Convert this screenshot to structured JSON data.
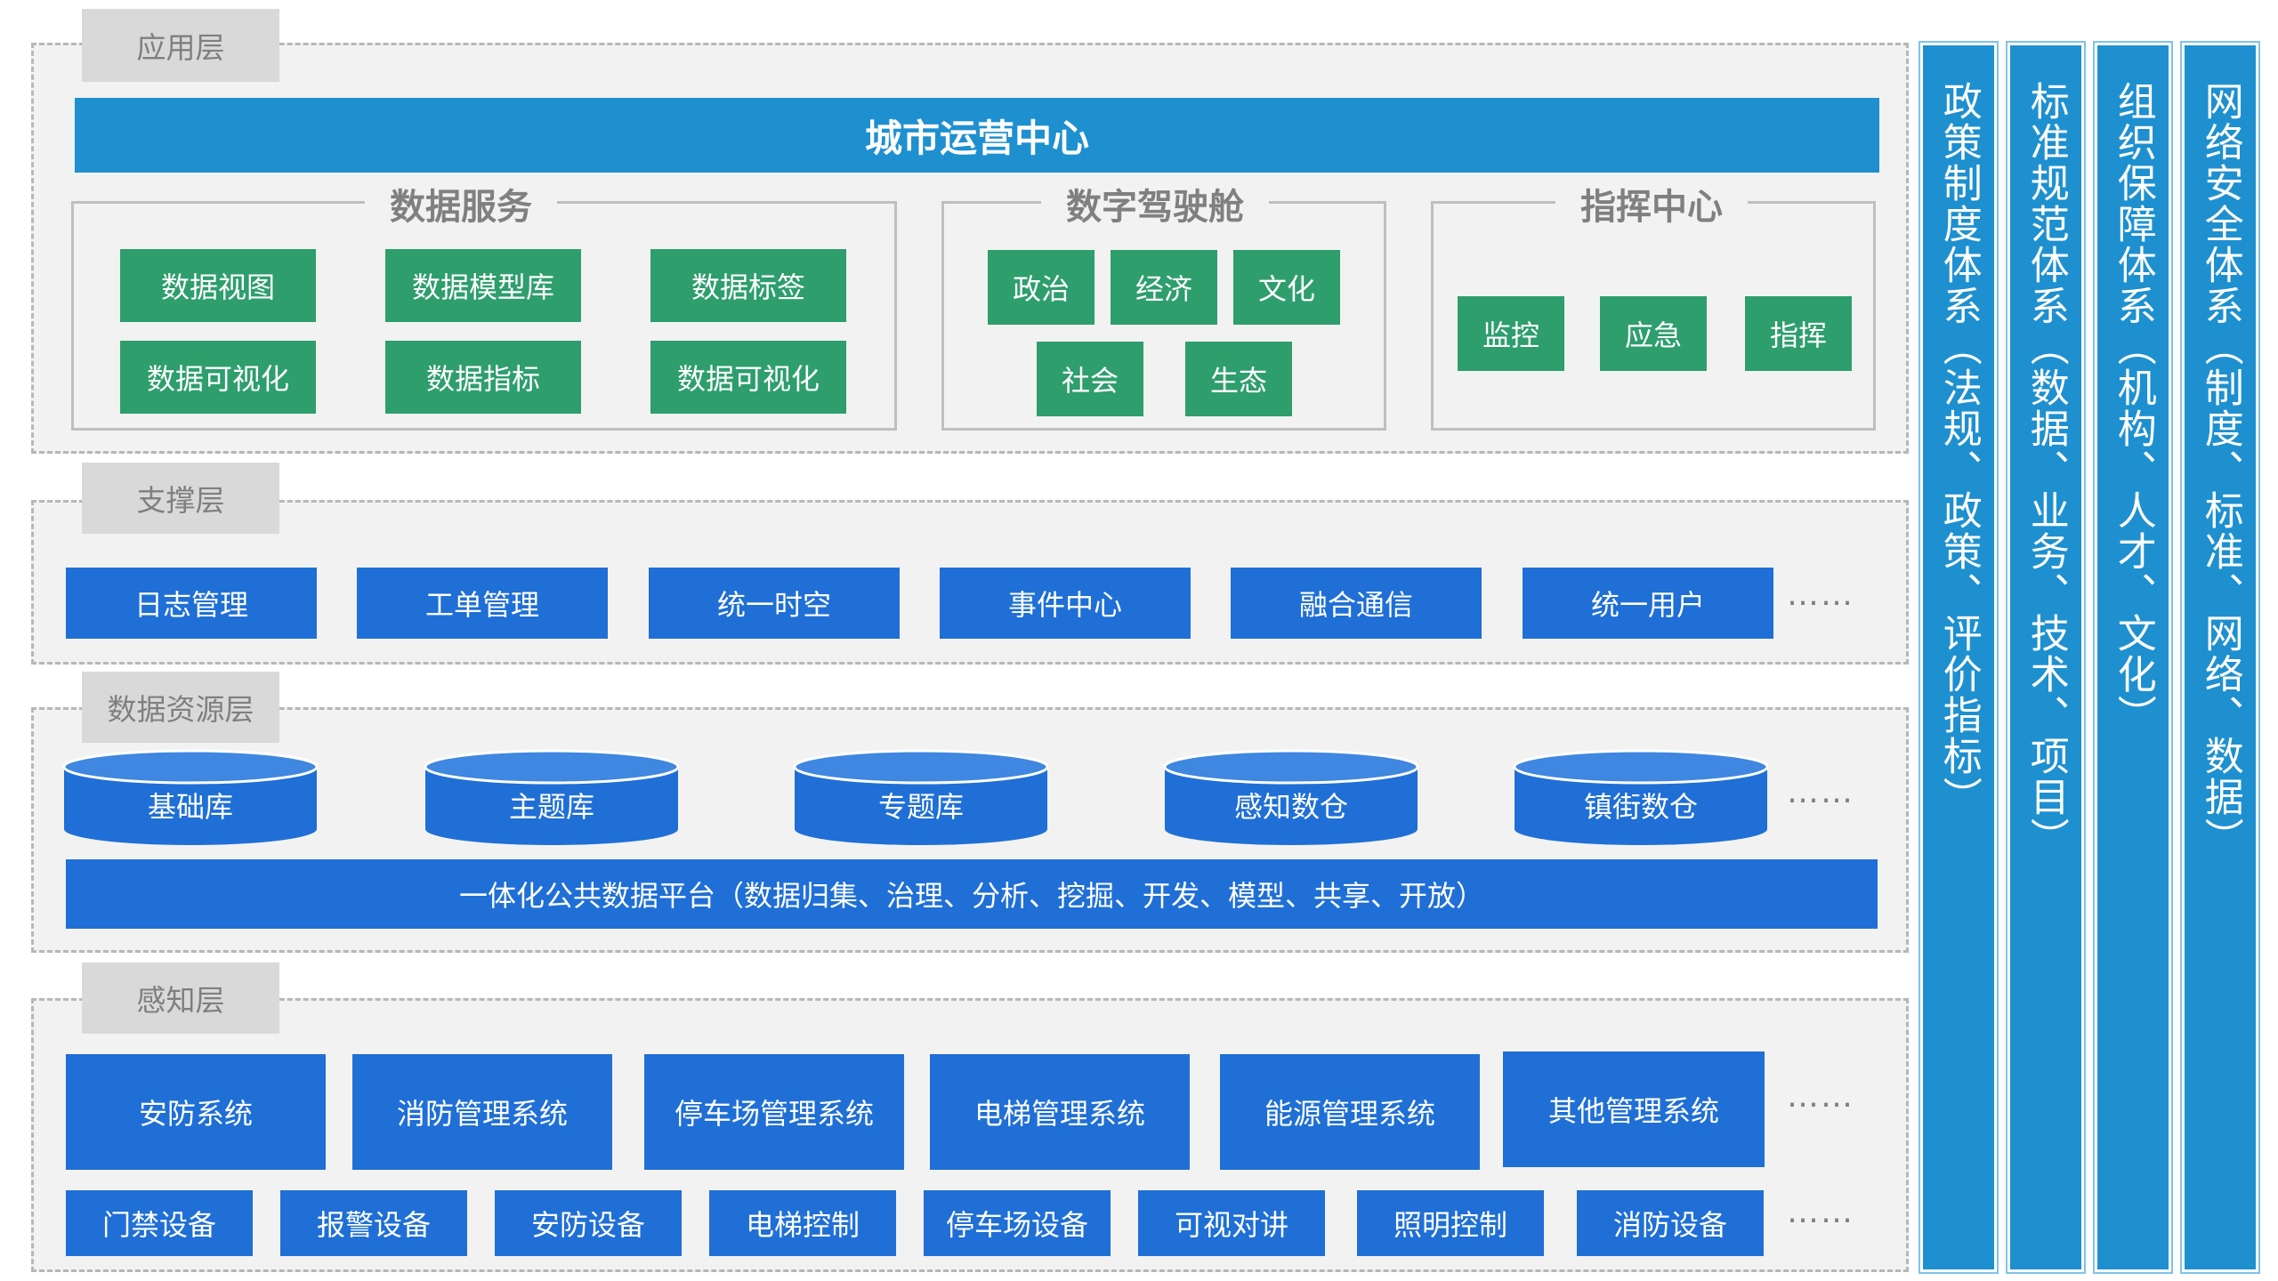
{
  "app_layer": {
    "tag": "应用层",
    "banner": "城市运营中心",
    "data_services": {
      "title": "数据服务",
      "items": [
        "数据视图",
        "数据模型库",
        "数据标签",
        "数据可视化",
        "数据指标",
        "数据可视化"
      ]
    },
    "digital_cockpit": {
      "title": "数字驾驶舱",
      "items": [
        "政治",
        "经济",
        "文化",
        "社会",
        "生态"
      ]
    },
    "command_center": {
      "title": "指挥中心",
      "items": [
        "监控",
        "应急",
        "指挥"
      ]
    }
  },
  "support_layer": {
    "tag": "支撑层",
    "items": [
      "日志管理",
      "工单管理",
      "统一时空",
      "事件中心",
      "融合通信",
      "统一用户"
    ],
    "more": "……"
  },
  "data_resource_layer": {
    "tag": "数据资源层",
    "databases": [
      "基础库",
      "主题库",
      "专题库",
      "感知数仓",
      "镇街数仓"
    ],
    "more": "……",
    "platform": "一体化公共数据平台（数据归集、治理、分析、挖掘、开发、模型、共享、开放）"
  },
  "perception_layer": {
    "tag": "感知层",
    "systems": [
      "安防系统",
      "消防管理系统",
      "停车场管理系统",
      "电梯管理系统",
      "能源管理系统",
      "其他管理系统"
    ],
    "devices": [
      "门禁设备",
      "报警设备",
      "安防设备",
      "电梯控制",
      "停车场设备",
      "可视对讲",
      "照明控制",
      "消防设备"
    ],
    "more": "……"
  },
  "pillars": [
    "政策制度体系（法规、政策、评价指标）",
    "标准规范体系（数据、业务、技术、项目）",
    "组织保障体系（机构、人才、文化）",
    "网络安全体系（制度、标准、网络、数据）"
  ],
  "colors": {
    "banner": "#1e90d0",
    "green": "#2e9e6d",
    "blue": "#1f6fd6",
    "tag_bg": "#d9d9d9",
    "layer_bg": "#f2f2f2"
  }
}
